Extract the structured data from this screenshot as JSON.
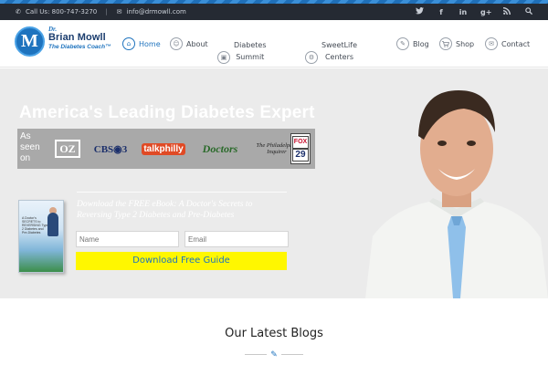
{
  "topbar": {
    "phone_label": "Call Us: 800-747-3270",
    "separator": "|",
    "email": "info@drmowll.com",
    "socials": [
      "twitter-icon",
      "facebook-icon",
      "linkedin-icon",
      "google-plus-icon",
      "rss-icon",
      "search-icon"
    ]
  },
  "logo": {
    "initial": "M",
    "dr": "Dr.",
    "name": "Brian Mowll",
    "tagline": "The Diabetes Coach™"
  },
  "nav": {
    "items": [
      {
        "label": "Home",
        "icon": "home-icon",
        "active": true
      },
      {
        "label": "About",
        "icon": "person-icon"
      },
      {
        "label_line1": "Diabetes",
        "label_line2": "Summit",
        "icon": "monitor-icon"
      },
      {
        "label_line1": "SweetLife",
        "label_line2": "Centers",
        "icon": "gear-icon"
      },
      {
        "label": "Blog",
        "icon": "pencil-icon"
      },
      {
        "label": "Shop",
        "icon": "cart-icon"
      },
      {
        "label": "Contact",
        "icon": "chat-icon"
      }
    ]
  },
  "hero": {
    "title": "America's Leading Diabetes Expert",
    "as_seen_on": "As seen on",
    "media": {
      "oz": "OZ",
      "cbs": "CBS◉3",
      "talkphilly": "talkphilly",
      "doctors": "Doctors",
      "inquirer_line1": "The Philadelphia",
      "inquirer_line2": "Inquirer",
      "fox_line1": "FOX",
      "fox_line2": "29"
    },
    "ebook_title": "Download the FREE eBook: A Doctor's Secrets to Reversing Type 2 Diabetes and Pre-Diabetes",
    "ebook_cover_text": "A Doctor's SECRETS to REVERSING Type 2 Diabetes and Pre-Diabetes",
    "name_placeholder": "Name",
    "email_placeholder": "Email",
    "download_button": "Download Free Guide"
  },
  "blogs": {
    "title": "Our Latest Blogs"
  },
  "colors": {
    "accent": "#1e73be",
    "topbar_bg": "#252a33",
    "hero_bg": "#ebebeb",
    "button_bg": "#fff700"
  }
}
